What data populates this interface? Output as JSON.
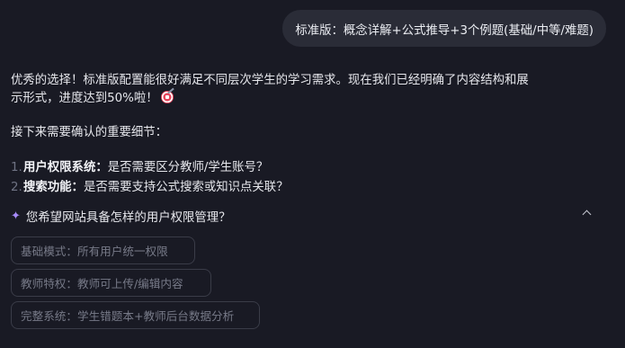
{
  "user_message": "标准版：概念详解+公式推导+3个例题(基础/中等/难题)",
  "assistant": {
    "intro": "优秀的选择！标准版配置能很好满足不同层次学生的学习需求。现在我们已经明确了内容结构和展示形式，进度达到50%啦！",
    "progress_percent": 50,
    "emoji": "target-icon",
    "subheading": "接下来需要确认的重要细节：",
    "items": [
      {
        "num": "1.",
        "key": "用户权限系统：",
        "value": "是否需要区分教师/学生账号？"
      },
      {
        "num": "2.",
        "key": "搜索功能：",
        "value": "是否需要支持公式搜索或知识点关联？"
      }
    ]
  },
  "question": {
    "text": "您希望网站具备怎样的用户权限管理？",
    "icon": "sparkle-icon",
    "toggle_icon": "chevron-up-icon"
  },
  "options": [
    "基础模式：所有用户统一权限",
    "教师特权：教师可上传/编辑内容",
    "完整系统：学生错题本+教师后台数据分析"
  ],
  "colors": {
    "background": "#191a24",
    "bubble": "#2a2c37",
    "accent": "#a78bfa",
    "option_border": "#3a3c48"
  }
}
